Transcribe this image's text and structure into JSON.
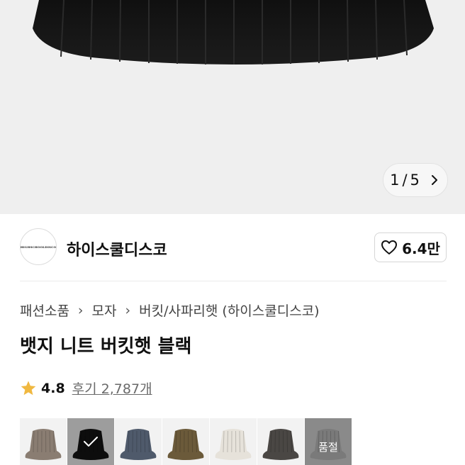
{
  "gallery": {
    "current": "1",
    "total": "5",
    "separator": "/"
  },
  "brand": {
    "logo_text": "HIGHSCHOOLDISCO",
    "name": "하이스쿨디스코",
    "likes": "6.4만"
  },
  "breadcrumb": [
    "패션소품",
    "모자",
    "버킷/사파리햇",
    "(하이스쿨디스코)"
  ],
  "product": {
    "title": "뱃지 니트 버킷햇 블랙"
  },
  "rating": {
    "score": "4.8",
    "reviews_label": "후기 2,787개"
  },
  "swatches": [
    {
      "color": "#8a7d72",
      "selected": false,
      "sold_out": false
    },
    {
      "color": "#151515",
      "selected": true,
      "sold_out": false
    },
    {
      "color": "#4f5a6b",
      "selected": false,
      "sold_out": false
    },
    {
      "color": "#6b5a3a",
      "selected": false,
      "sold_out": false
    },
    {
      "color": "#e6e2da",
      "selected": false,
      "sold_out": false
    },
    {
      "color": "#4a4744",
      "selected": false,
      "sold_out": false
    },
    {
      "color": "#7a7a7a",
      "selected": false,
      "sold_out": true,
      "label": "품절"
    }
  ],
  "colors": {
    "star": "#f0b840",
    "hero_bg": "#efefef"
  }
}
